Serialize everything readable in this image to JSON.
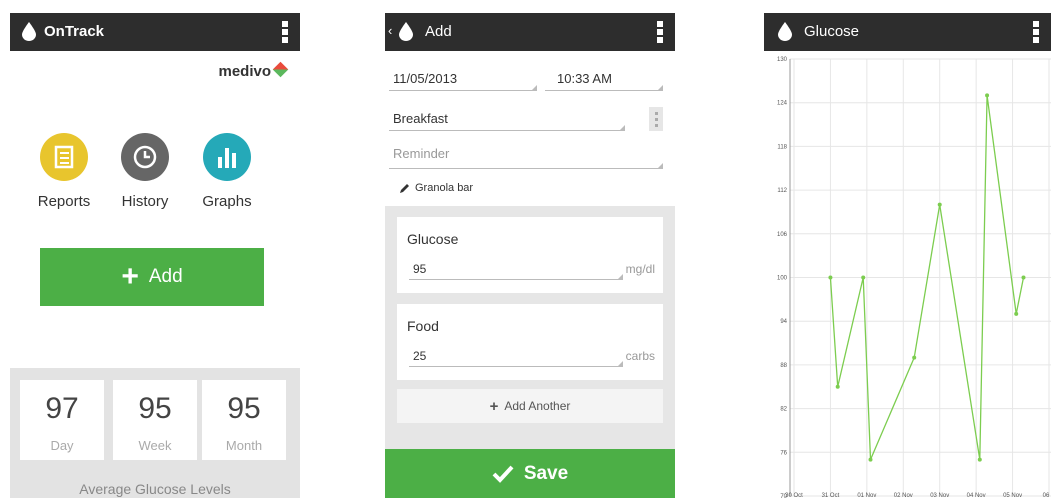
{
  "screen1": {
    "app_title": "OnTrack",
    "brand": "medivo",
    "actions": [
      {
        "label": "Reports",
        "color": "#e8c52d",
        "icon": "reports-icon"
      },
      {
        "label": "History",
        "color": "#666666",
        "icon": "clock-icon"
      },
      {
        "label": "Graphs",
        "color": "#25a9b8",
        "icon": "bar-chart-icon"
      }
    ],
    "add_label": "Add",
    "stats": [
      {
        "value": "97",
        "label": "Day"
      },
      {
        "value": "95",
        "label": "Week"
      },
      {
        "value": "95",
        "label": "Month"
      }
    ],
    "stats_caption": "Average Glucose Levels"
  },
  "screen2": {
    "title": "Add",
    "date": "11/05/2013",
    "time": "10:33 AM",
    "meal": "Breakfast",
    "reminder_placeholder": "Reminder",
    "note": "Granola bar",
    "glucose": {
      "title": "Glucose",
      "value": "95",
      "unit": "mg/dl"
    },
    "food": {
      "title": "Food",
      "value": "25",
      "unit": "carbs"
    },
    "add_another": "Add Another",
    "save": "Save"
  },
  "screen3": {
    "title": "Glucose",
    "chart_data": {
      "type": "line",
      "ylim": [
        70,
        130
      ],
      "yticks": [
        70,
        76,
        82,
        88,
        94,
        100,
        106,
        112,
        118,
        124,
        130
      ],
      "xticks": [
        "30 Oct",
        "31 Oct",
        "01 Nov",
        "02 Nov",
        "03 Nov",
        "04 Nov",
        "05 Nov",
        "06 N"
      ],
      "grid": true,
      "line_color": "#7ccd4f",
      "x": [
        1.0,
        1.2,
        1.9,
        2.1,
        3.3,
        4.0,
        5.1,
        5.3,
        6.1,
        6.3
      ],
      "values": [
        100,
        85,
        100,
        75,
        89,
        110,
        75,
        125,
        95,
        100
      ]
    }
  },
  "colors": {
    "bar": "#2d2d2d",
    "green": "#4caf46"
  }
}
